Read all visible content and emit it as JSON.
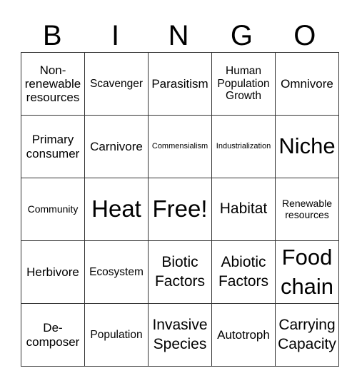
{
  "header": {
    "letters": [
      "B",
      "I",
      "N",
      "G",
      "O"
    ]
  },
  "cells": [
    [
      "Non-renewable resources",
      "Scavenger",
      "Parasitism",
      "Human Population Growth",
      "Omnivore"
    ],
    [
      "Primary consumer",
      "Carnivore",
      "Commensialism",
      "Industrialization",
      "Niche"
    ],
    [
      "Community",
      "Heat",
      "Free!",
      "Habitat",
      "Renewable resources"
    ],
    [
      "Herbivore",
      "Ecosystem",
      "Biotic Factors",
      "Abiotic Factors",
      "Food chain"
    ],
    [
      "De-composer",
      "Population",
      "Invasive Species",
      "Autotroph",
      "Carrying Capacity"
    ]
  ],
  "free_space_label": "Free!"
}
